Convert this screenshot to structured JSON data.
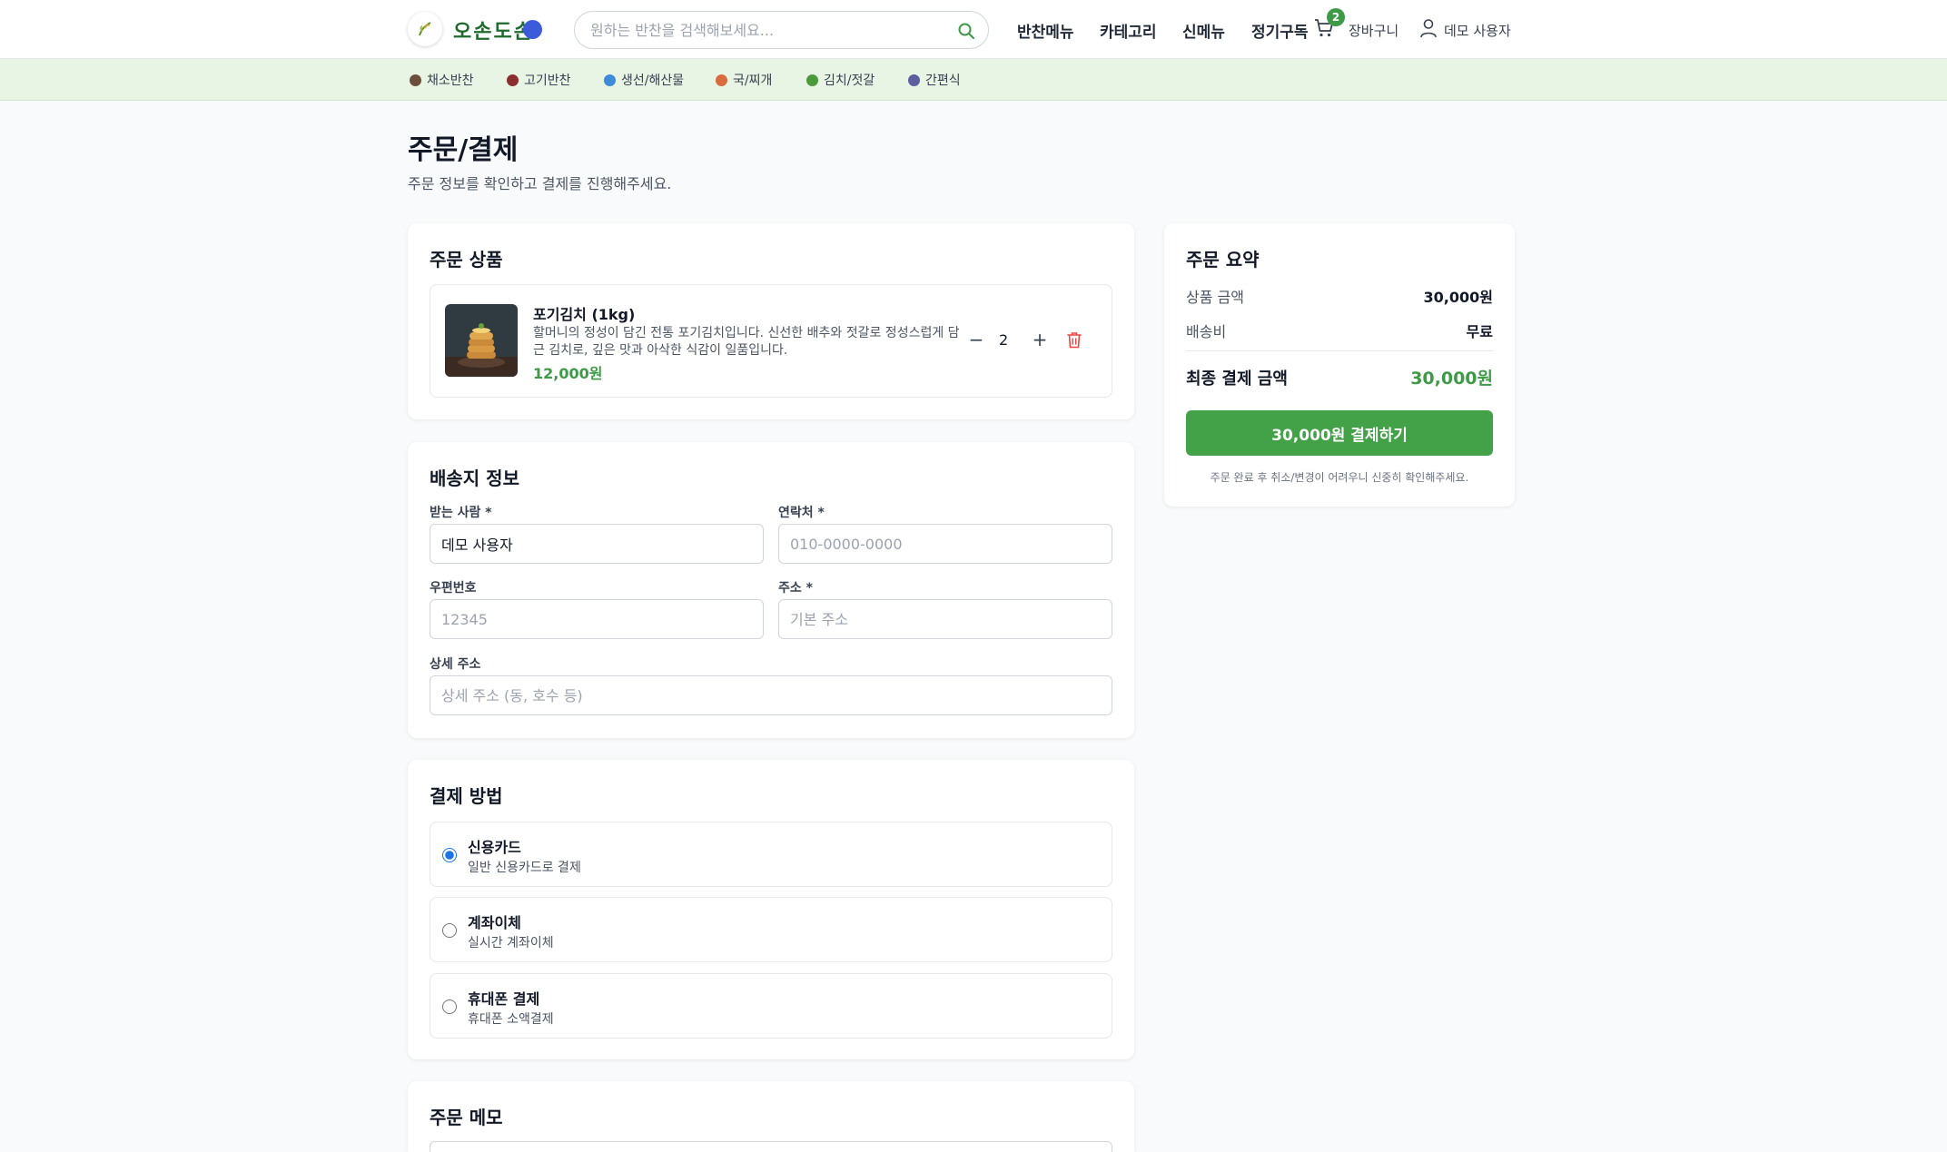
{
  "header": {
    "brand": "오손도손",
    "search_placeholder": "원하는 반찬을 검색해보세요...",
    "nav": [
      "반찬메뉴",
      "카테고리",
      "신메뉴",
      "정기구독"
    ],
    "cart_count": "2",
    "cart_label": "장바구니",
    "user_label": "데모 사용자"
  },
  "categories": [
    {
      "label": "채소반찬",
      "color": "#6b4f3a"
    },
    {
      "label": "고기반찬",
      "color": "#8b2e2e"
    },
    {
      "label": "생선/해산물",
      "color": "#3d8bd9"
    },
    {
      "label": "국/찌개",
      "color": "#d96b3d"
    },
    {
      "label": "김치/젓갈",
      "color": "#4a9a3b"
    },
    {
      "label": "간편식",
      "color": "#5b5f9e"
    }
  ],
  "page": {
    "title": "주문/결제",
    "subtitle": "주문 정보를 확인하고 결제를 진행해주세요."
  },
  "order_items": {
    "title": "주문 상품",
    "items": [
      {
        "name": "포기김치 (1kg)",
        "description": "할머니의 정성이 담긴 전통 포기김치입니다. 신선한 배추와 젓갈로 정성스럽게 담근 김치로, 깊은 맛과 아삭한 식감이 일품입니다.",
        "price": "12,000원",
        "quantity": "2"
      }
    ]
  },
  "shipping": {
    "title": "배송지 정보",
    "recipient_label": "받는 사람 *",
    "recipient_value": "데모 사용자",
    "phone_label": "연락처 *",
    "phone_placeholder": "010-0000-0000",
    "zip_label": "우편번호",
    "zip_placeholder": "12345",
    "address_label": "주소 *",
    "address_placeholder": "기본 주소",
    "detail_label": "상세 주소",
    "detail_placeholder": "상세 주소 (동, 호수 등)"
  },
  "payment": {
    "title": "결제 방법",
    "options": [
      {
        "name": "신용카드",
        "desc": "일반 신용카드로 결제",
        "selected": true
      },
      {
        "name": "계좌이체",
        "desc": "실시간 계좌이체",
        "selected": false
      },
      {
        "name": "휴대폰 결제",
        "desc": "휴대폰 소액결제",
        "selected": false
      }
    ]
  },
  "memo": {
    "title": "주문 메모"
  },
  "summary": {
    "title": "주문 요약",
    "subtotal_label": "상품 금액",
    "subtotal_value": "30,000원",
    "shipping_label": "배송비",
    "shipping_value": "무료",
    "total_label": "최종 결제 금액",
    "total_value": "30,000원",
    "pay_button": "30,000원 결제하기",
    "note": "주문 완료 후 취소/변경이 어려우니 신중히 확인해주세요."
  },
  "colors": {
    "brand_green": "#3e9a46",
    "button_green": "#43a148",
    "category_bg": "#e8f4e4",
    "trash_red": "#ef4444"
  },
  "icons": [
    "leaf-logo-icon",
    "blueberry-icon",
    "search-icon",
    "cart-icon",
    "user-icon",
    "trash-icon"
  ]
}
